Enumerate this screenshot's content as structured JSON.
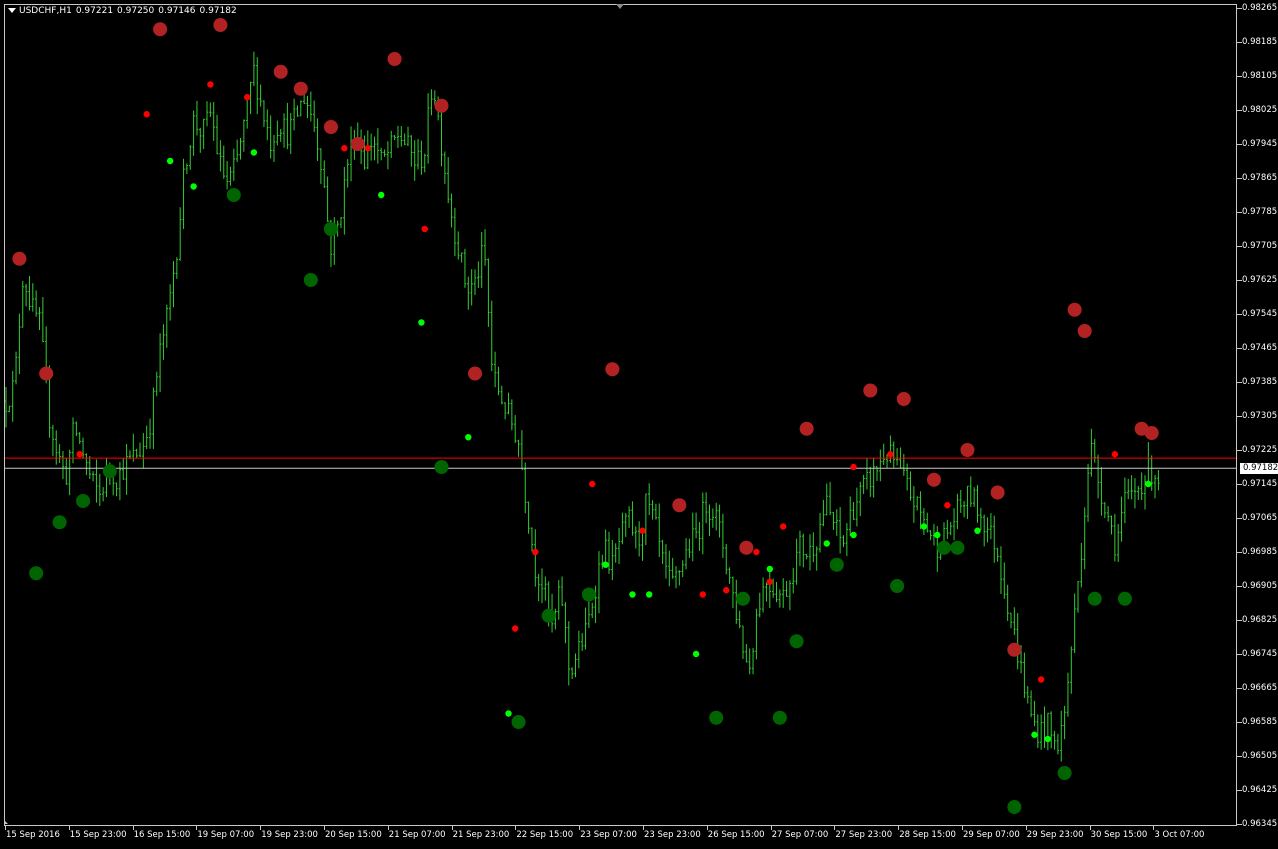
{
  "window": {
    "symbol_label": "USDCHF,H1",
    "ohlc": [
      "0.97221",
      "0.97250",
      "0.97146",
      "0.97182"
    ]
  },
  "colors": {
    "background": "#000000",
    "bars": "#32cd32",
    "grid_axis": "#c8c8c8",
    "big_high_dot": "#b22222",
    "small_high_dot": "#ff0000",
    "big_low_dot": "#006400",
    "small_low_dot": "#00ff00",
    "bid_line": "#c8c8c8",
    "ask_line": "#ff0000"
  },
  "chart_data": {
    "type": "ohlc",
    "title": "",
    "ylim": [
      0.96345,
      0.98265
    ],
    "y_ticks": [
      "0.98265",
      "0.98185",
      "0.98105",
      "0.98025",
      "0.97945",
      "0.97865",
      "0.97785",
      "0.97705",
      "0.97625",
      "0.97545",
      "0.97465",
      "0.97385",
      "0.97305",
      "0.97225",
      "0.97145",
      "0.97065",
      "0.96985",
      "0.96905",
      "0.96825",
      "0.96745",
      "0.96665",
      "0.96585",
      "0.96505",
      "0.96425",
      "0.96345"
    ],
    "x_labels": [
      "15 Sep 2016",
      "15 Sep 23:00",
      "16 Sep 15:00",
      "19 Sep 07:00",
      "19 Sep 23:00",
      "20 Sep 15:00",
      "21 Sep 07:00",
      "21 Sep 23:00",
      "22 Sep 15:00",
      "23 Sep 07:00",
      "23 Sep 23:00",
      "26 Sep 15:00",
      "27 Sep 07:00",
      "27 Sep 23:00",
      "28 Sep 15:00",
      "29 Sep 07:00",
      "29 Sep 23:00",
      "30 Sep 15:00",
      "3 Oct 07:00"
    ],
    "current_price": "0.97182",
    "ask_price": 0.97206,
    "close_path": [
      0.9734,
      0.9738,
      0.9764,
      0.9756,
      0.9752,
      0.9731,
      0.9722,
      0.9716,
      0.9728,
      0.9722,
      0.9715,
      0.9712,
      0.9718,
      0.9716,
      0.9719,
      0.9721,
      0.9723,
      0.973,
      0.9745,
      0.9755,
      0.977,
      0.979,
      0.98,
      0.9797,
      0.9802,
      0.979,
      0.9785,
      0.979,
      0.98,
      0.9812,
      0.9803,
      0.9795,
      0.98,
      0.9797,
      0.9801,
      0.9806,
      0.98,
      0.979,
      0.977,
      0.9776,
      0.979,
      0.9798,
      0.9791,
      0.9796,
      0.979,
      0.9793,
      0.9797,
      0.9794,
      0.979,
      0.9792,
      0.981,
      0.9795,
      0.978,
      0.977,
      0.976,
      0.9762,
      0.977,
      0.974,
      0.9735,
      0.973,
      0.9725,
      0.971,
      0.9695,
      0.969,
      0.968,
      0.969,
      0.967,
      0.9675,
      0.968,
      0.969,
      0.97,
      0.9695,
      0.9702,
      0.9706,
      0.97,
      0.971,
      0.9705,
      0.9695,
      0.969,
      0.9695,
      0.97,
      0.9703,
      0.971,
      0.9708,
      0.97,
      0.969,
      0.968,
      0.967,
      0.9685,
      0.9692,
      0.969,
      0.9688,
      0.9693,
      0.97,
      0.9698,
      0.9702,
      0.971,
      0.9705,
      0.97,
      0.9708,
      0.9712,
      0.9715,
      0.9718,
      0.9722,
      0.972,
      0.9716,
      0.9712,
      0.9708,
      0.9704,
      0.97,
      0.9702,
      0.9706,
      0.971,
      0.9712,
      0.9708,
      0.9704,
      0.97,
      0.969,
      0.968,
      0.967,
      0.966,
      0.9656,
      0.9658,
      0.9652,
      0.966,
      0.968,
      0.97,
      0.9724,
      0.9715,
      0.9708,
      0.97,
      0.971,
      0.9712,
      0.9715,
      0.9718,
      0.9716
    ],
    "markers": {
      "big_high": [
        [
          4,
          0.97675
        ],
        [
          12,
          0.97405
        ],
        [
          46,
          0.98215
        ],
        [
          64,
          0.98225
        ],
        [
          82,
          0.98115
        ],
        [
          88,
          0.98075
        ],
        [
          97,
          0.97985
        ],
        [
          105,
          0.97945
        ],
        [
          116,
          0.98145
        ],
        [
          130,
          0.98035
        ],
        [
          140,
          0.97405
        ],
        [
          181,
          0.97415
        ],
        [
          201,
          0.97095
        ],
        [
          221,
          0.96995
        ],
        [
          239,
          0.97275
        ],
        [
          258,
          0.97365
        ],
        [
          268,
          0.97345
        ],
        [
          277,
          0.97155
        ],
        [
          287,
          0.97225
        ],
        [
          296,
          0.97125
        ],
        [
          301,
          0.96755
        ],
        [
          319,
          0.97555
        ],
        [
          322,
          0.97505
        ],
        [
          339,
          0.97275
        ],
        [
          342,
          0.97265
        ]
      ],
      "small_high": [
        [
          42,
          0.98015
        ],
        [
          61,
          0.98085
        ],
        [
          72,
          0.98055
        ],
        [
          101,
          0.97935
        ],
        [
          108,
          0.97935
        ],
        [
          125,
          0.97745
        ],
        [
          22,
          0.97215
        ],
        [
          152,
          0.96805
        ],
        [
          158,
          0.96985
        ],
        [
          175,
          0.97145
        ],
        [
          190,
          0.97035
        ],
        [
          208,
          0.96885
        ],
        [
          215,
          0.96895
        ],
        [
          224,
          0.96985
        ],
        [
          228,
          0.96915
        ],
        [
          232,
          0.97045
        ],
        [
          253,
          0.97185
        ],
        [
          264,
          0.97215
        ],
        [
          281,
          0.97095
        ],
        [
          309,
          0.96685
        ],
        [
          331,
          0.97215
        ]
      ],
      "big_low": [
        [
          9,
          0.96935
        ],
        [
          16,
          0.97055
        ],
        [
          23,
          0.97105
        ],
        [
          31,
          0.97175
        ],
        [
          68,
          0.97825
        ],
        [
          91,
          0.97625
        ],
        [
          97,
          0.97745
        ],
        [
          130,
          0.97185
        ],
        [
          153,
          0.96585
        ],
        [
          162,
          0.96835
        ],
        [
          174,
          0.96885
        ],
        [
          212,
          0.96595
        ],
        [
          220,
          0.96875
        ],
        [
          231,
          0.96595
        ],
        [
          236,
          0.96775
        ],
        [
          248,
          0.96955
        ],
        [
          266,
          0.96905
        ],
        [
          280,
          0.96995
        ],
        [
          284,
          0.96995
        ],
        [
          301,
          0.96385
        ],
        [
          316,
          0.96465
        ],
        [
          325,
          0.96875
        ],
        [
          334,
          0.96875
        ]
      ],
      "small_low": [
        [
          49,
          0.97905
        ],
        [
          56,
          0.97845
        ],
        [
          74,
          0.97925
        ],
        [
          112,
          0.97825
        ],
        [
          124,
          0.97525
        ],
        [
          138,
          0.97255
        ],
        [
          150,
          0.96605
        ],
        [
          179,
          0.96955
        ],
        [
          187,
          0.96885
        ],
        [
          192,
          0.96885
        ],
        [
          206,
          0.96745
        ],
        [
          228,
          0.96945
        ],
        [
          245,
          0.97005
        ],
        [
          253,
          0.97025
        ],
        [
          274,
          0.97045
        ],
        [
          278,
          0.97025
        ],
        [
          290,
          0.97035
        ],
        [
          307,
          0.96555
        ],
        [
          311,
          0.96545
        ],
        [
          341,
          0.97145
        ]
      ]
    }
  }
}
